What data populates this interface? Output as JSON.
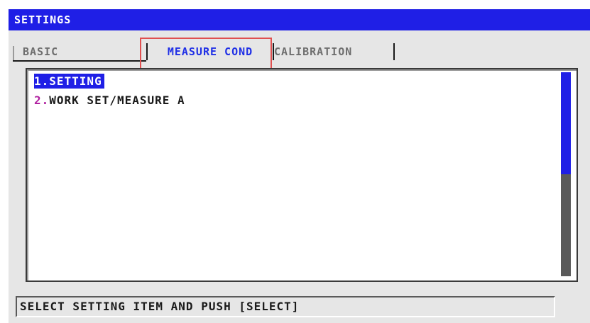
{
  "window": {
    "title": "SETTINGS"
  },
  "tabs": [
    {
      "label": "BASIC",
      "active": false
    },
    {
      "label": "MEASURE COND",
      "active": true
    },
    {
      "label": "CALIBRATION",
      "active": false
    }
  ],
  "list": {
    "items": [
      {
        "number": "1.",
        "label": "SETTING",
        "selected": true
      },
      {
        "number": "2.",
        "label": "WORK SET/MEASURE A",
        "selected": false
      }
    ],
    "scroll_position": 0.5
  },
  "status": {
    "message": "SELECT SETTING ITEM AND PUSH [SELECT]"
  },
  "colors": {
    "title_bar": "#1f1fe6",
    "active_tab_text": "#1f2fe6",
    "inactive_tab_text": "#6e6e6e",
    "selection_bg": "#1f1fe6",
    "item_number_accent": "#b020a0",
    "highlight_outline": "#e05050",
    "panel_bg": "#e6e6e6"
  }
}
